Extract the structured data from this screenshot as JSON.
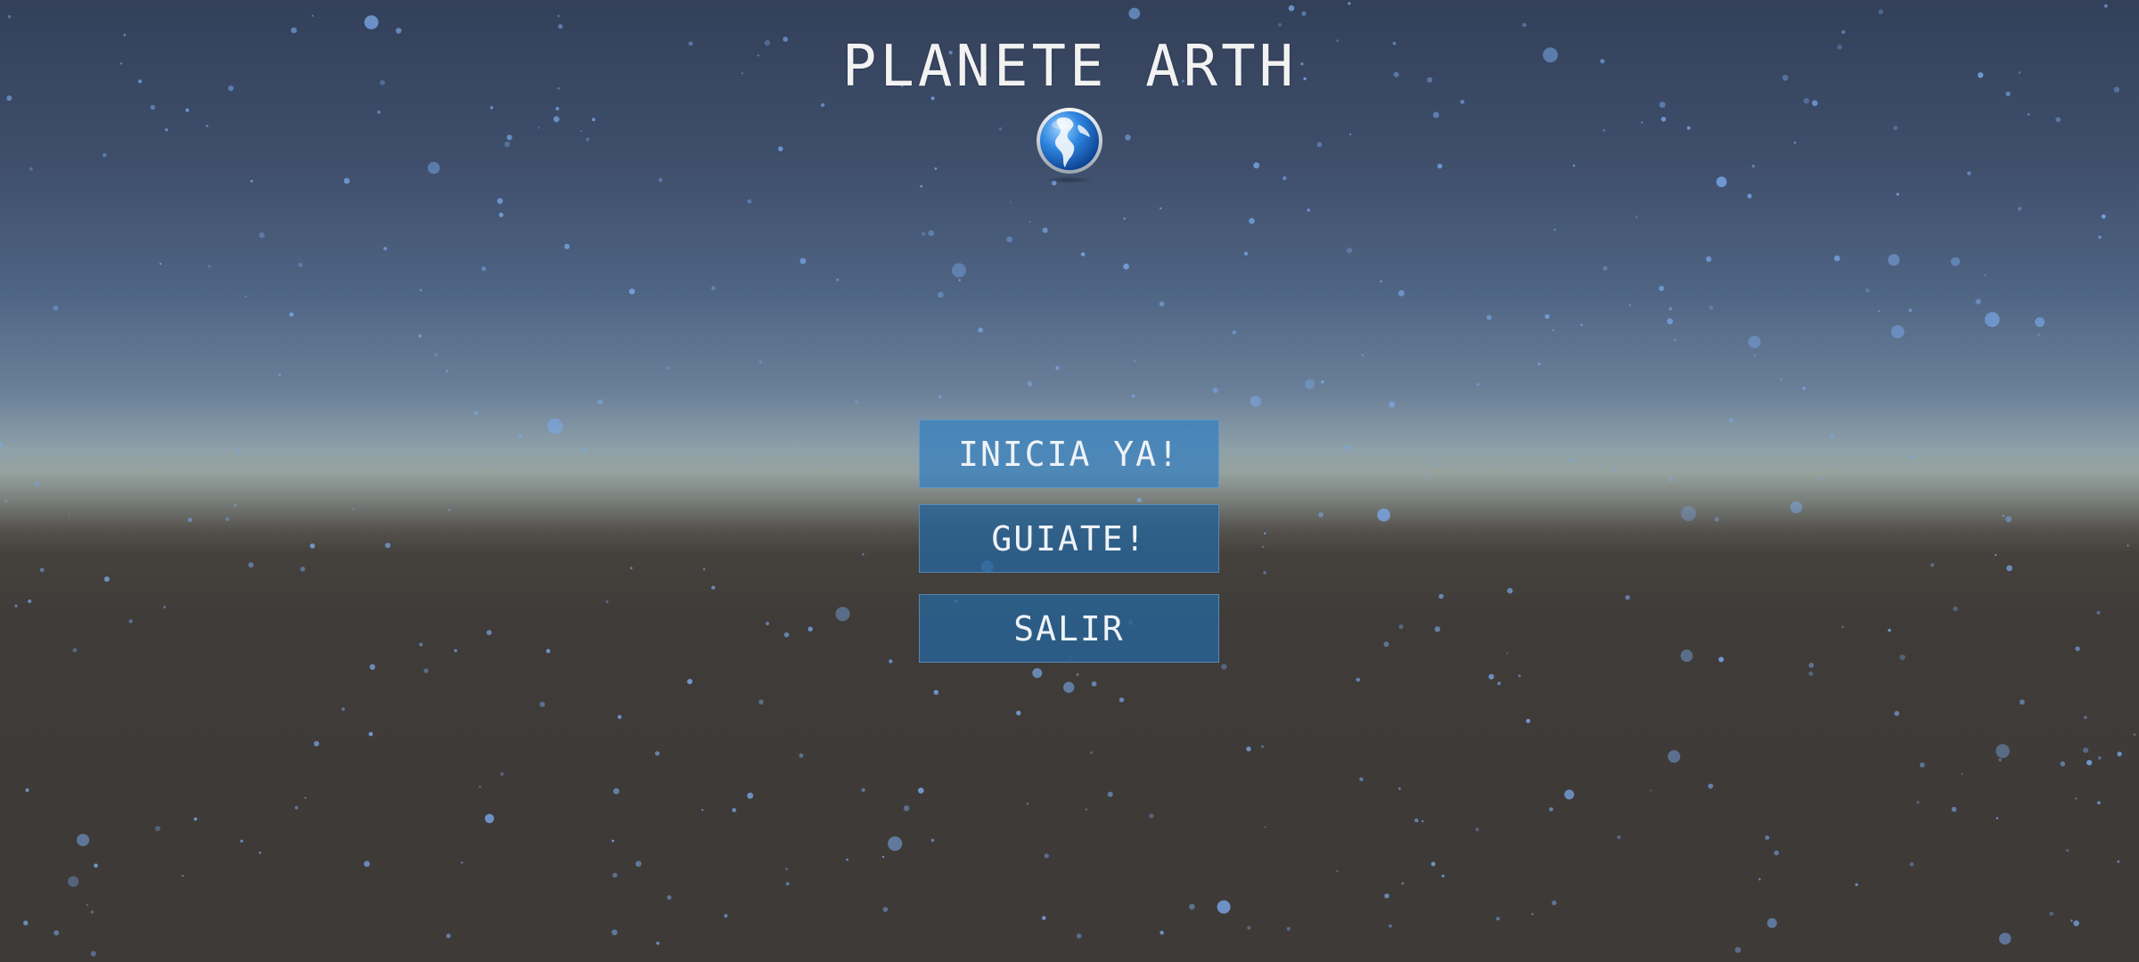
{
  "game": {
    "title": "PLANETE ARTH",
    "logo_icon": "globe-icon"
  },
  "menu": {
    "start_label": "INICIA YA!",
    "guide_label": "GUIATE!",
    "exit_label": "SALIR"
  },
  "colors": {
    "sky_top": "#33405a",
    "horizon": "#96a39f",
    "ground": "#3e3a37",
    "button_primary": "#3a80be",
    "button": "#286496",
    "star": "#7aa8e8"
  }
}
